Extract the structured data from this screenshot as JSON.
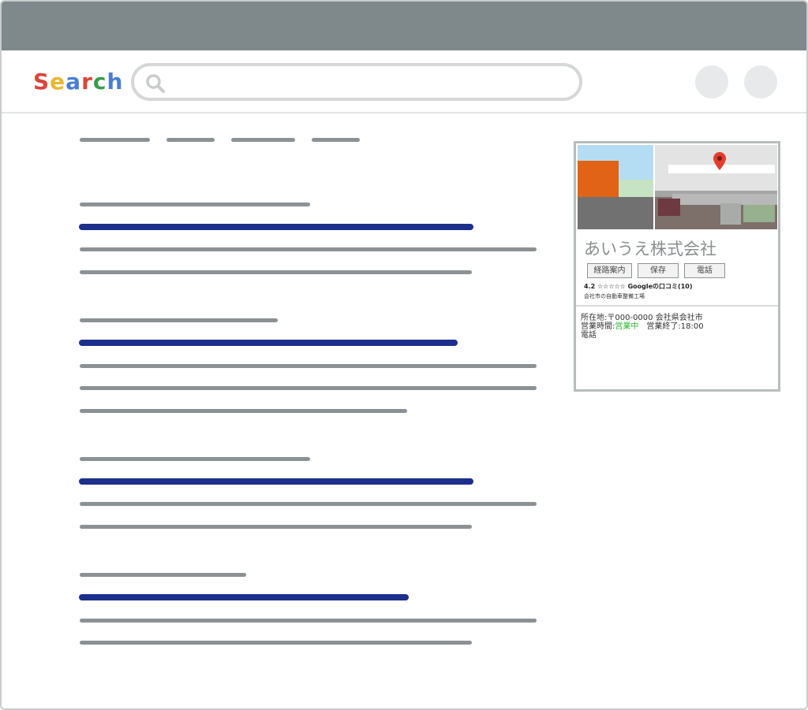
{
  "logo": {
    "letters": [
      "S",
      "e",
      "a",
      "r",
      "c",
      "h"
    ],
    "colors": [
      "#d9463a",
      "#e9b630",
      "#4a7ed0",
      "#d9463a",
      "#3a9c4d",
      "#4a7ed0"
    ]
  },
  "search": {
    "value": "",
    "placeholder": ""
  },
  "colors": {
    "title_bar": "#7f888b",
    "result_title": "#1c2f8c",
    "result_text": "#8b9194",
    "open_status": "#2db52d"
  },
  "business": {
    "name": "あいうえ株式会社",
    "buttons": [
      "経路案内",
      "保存",
      "電話"
    ],
    "rating": "4.2 ☆☆☆☆☆ Googleの口コミ(10)",
    "category": "会社市の自動車整備工場",
    "address_label": "所在地:",
    "address": "〒000-0000 会社県会社市",
    "hours_label": "営業時間:",
    "hours_status": "営業中",
    "hours_close": "営業終了:18:00",
    "phone_label": "電話"
  }
}
